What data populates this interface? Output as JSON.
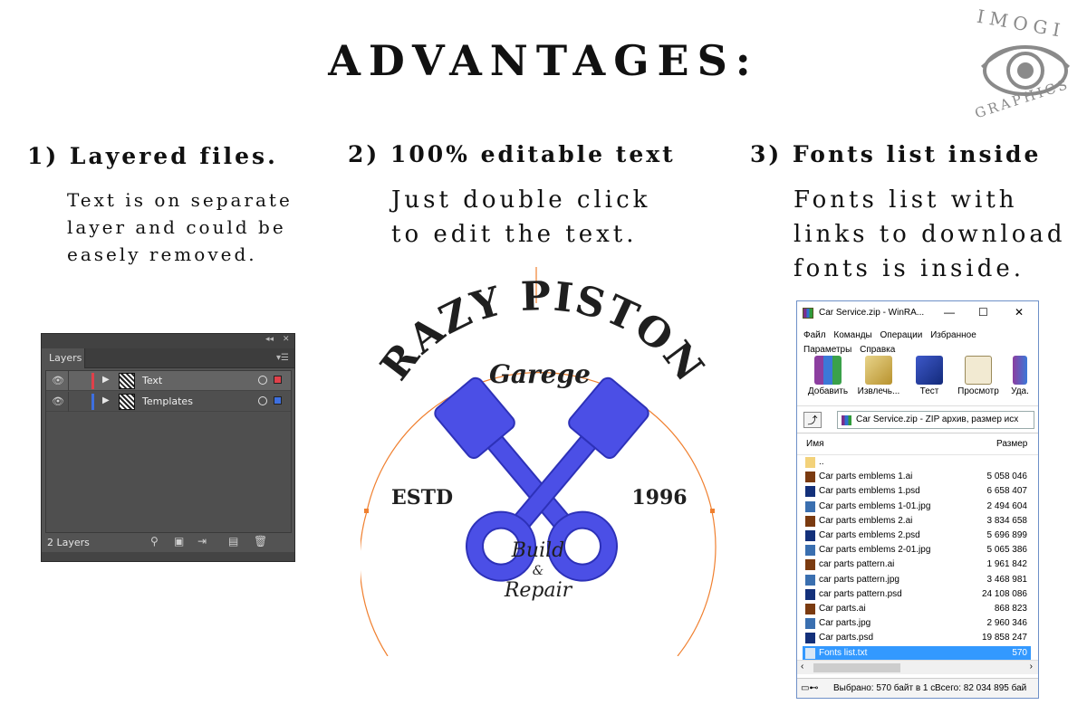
{
  "title": "ADVANTAGES:",
  "logo": {
    "top": "IMOGI",
    "bottom": "GRAPHICS",
    "icon": "eye-icon"
  },
  "columns": [
    {
      "heading": "1) Layered files.",
      "lines": [
        "Text is on separate",
        "layer and could be",
        "easely removed."
      ]
    },
    {
      "heading": "2) 100% editable text",
      "lines": [
        "Just double click",
        "to edit the text."
      ]
    },
    {
      "heading": "3) Fonts list inside",
      "lines": [
        "Fonts list with",
        "links to download",
        "fonts is inside."
      ]
    }
  ],
  "layers_panel": {
    "tab": "Layers",
    "layers": [
      {
        "name": "Text",
        "color": "#e0404a",
        "selected": true
      },
      {
        "name": "Templates",
        "color": "#3d6fe0",
        "selected": false
      }
    ],
    "count": "2 Layers",
    "icons": [
      "search-icon",
      "make-mask-icon",
      "move-layer-icon",
      "new-layer-icon",
      "trash-icon"
    ]
  },
  "badge": {
    "top_text": "CRAZY PISTONS",
    "script": "Garege",
    "left": "ESTD",
    "right": "1996",
    "bottom1": "Build",
    "amp": "&",
    "bottom2": "Repair",
    "piston_color": "#4b4fe6",
    "guide_color": "#f08030"
  },
  "winrar": {
    "title": "Car Service.zip - WinRA...",
    "controls": [
      "—",
      "☐",
      "✕"
    ],
    "menu": [
      "Файл",
      "Команды",
      "Операции",
      "Избранное",
      "Параметры",
      "Справка"
    ],
    "toolbar": [
      {
        "label": "Добавить",
        "icon": "add-archive-icon"
      },
      {
        "label": "Извлечь...",
        "icon": "extract-icon"
      },
      {
        "label": "Тест",
        "icon": "test-icon"
      },
      {
        "label": "Просмотр",
        "icon": "view-icon"
      },
      {
        "label": "Уда.",
        "icon": "delete-icon"
      }
    ],
    "address": "Car Service.zip - ZIP архив, размер исх",
    "columns": {
      "name": "Имя",
      "size": "Размер"
    },
    "files": [
      {
        "name": "..",
        "size": "",
        "type": "folder"
      },
      {
        "name": "Car parts emblems 1.ai",
        "size": "5 058 046",
        "type": "ai"
      },
      {
        "name": "Car parts emblems 1.psd",
        "size": "6 658 407",
        "type": "psd"
      },
      {
        "name": "Car parts emblems 1-01.jpg",
        "size": "2 494 604",
        "type": "jpg"
      },
      {
        "name": "Car parts emblems 2.ai",
        "size": "3 834 658",
        "type": "ai"
      },
      {
        "name": "Car parts emblems 2.psd",
        "size": "5 696 899",
        "type": "psd"
      },
      {
        "name": "Car parts emblems 2-01.jpg",
        "size": "5 065 386",
        "type": "jpg"
      },
      {
        "name": "car parts pattern.ai",
        "size": "1 961 842",
        "type": "ai"
      },
      {
        "name": "car parts pattern.jpg",
        "size": "3 468 981",
        "type": "jpg"
      },
      {
        "name": "car parts pattern.psd",
        "size": "24 108 086",
        "type": "psd"
      },
      {
        "name": "Car parts.ai",
        "size": "868 823",
        "type": "ai"
      },
      {
        "name": "Car parts.jpg",
        "size": "2 960 346",
        "type": "jpg"
      },
      {
        "name": "Car parts.psd",
        "size": "19 858 247",
        "type": "psd"
      },
      {
        "name": "Fonts list.txt",
        "size": "570",
        "type": "txt",
        "selected": true
      }
    ],
    "status_left": "Выбрано: 570 байт в 1 с",
    "status_right": "Всего: 82 034 895 бай"
  }
}
